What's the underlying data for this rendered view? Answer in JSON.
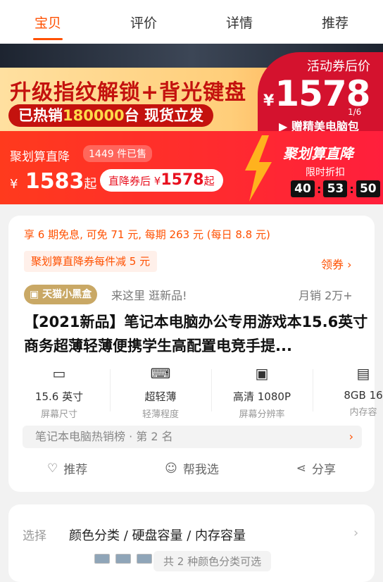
{
  "tabs": [
    "宝贝",
    "评价",
    "详情",
    "推荐"
  ],
  "hero": {
    "headline": "升级指纹解锁+背光键盘",
    "sold_prefix": "已热销",
    "sold_num": "180000",
    "sold_suffix": "台 现货立发",
    "badge_title": "活动券后价",
    "badge_currency": "¥",
    "badge_price": "1578",
    "badge_gift": "▶ 赠精美电脑包",
    "page": "1/6"
  },
  "deal": {
    "label": "聚划算直降",
    "sold": "1449 件已售",
    "currency": "¥",
    "price": "1583",
    "price_suffix": "起",
    "coupon_prefix": "直降券后",
    "coupon_currency": " ¥",
    "coupon_price": "1578",
    "coupon_suffix": "起",
    "brand": "聚划算直降",
    "limit": "限时折扣",
    "timer_h": "40",
    "timer_m": "53",
    "timer_s": "50"
  },
  "card": {
    "installment": "享 6 期免息, 可免 71 元, 每期 263 元 (每日 8.8 元)",
    "coupon": "聚划算直降券每件减 5 元",
    "get_coupon": "领券 ›",
    "store": "天猫小黑盒",
    "store_tip": "来这里 逛新品!",
    "monthly": "月销 2万+",
    "title": "【2021新品】笔记本电脑办公专用游戏本15.6英寸商务超薄轻薄便携学生高配置电竞手提...",
    "specs": [
      {
        "v": "15.6 英寸",
        "k": "屏幕尺寸",
        "icon": "screen-icon"
      },
      {
        "v": "超轻薄",
        "k": "轻薄程度",
        "icon": "laptop-icon"
      },
      {
        "v": "高清 1080P",
        "k": "屏幕分辨率",
        "icon": "resolution-icon"
      },
      {
        "v": "8GB 16",
        "k": "内存容",
        "icon": "memory-icon"
      }
    ],
    "rank": "笔记本电脑热销榜 · 第 2 名",
    "actions": [
      "推荐",
      "帮我选",
      "分享"
    ]
  },
  "select": {
    "label": "选择",
    "value": "颜色分类 / 硬盘容量 / 内存容量",
    "chevron": "›",
    "more": "共 2 种颜色分类可选"
  }
}
